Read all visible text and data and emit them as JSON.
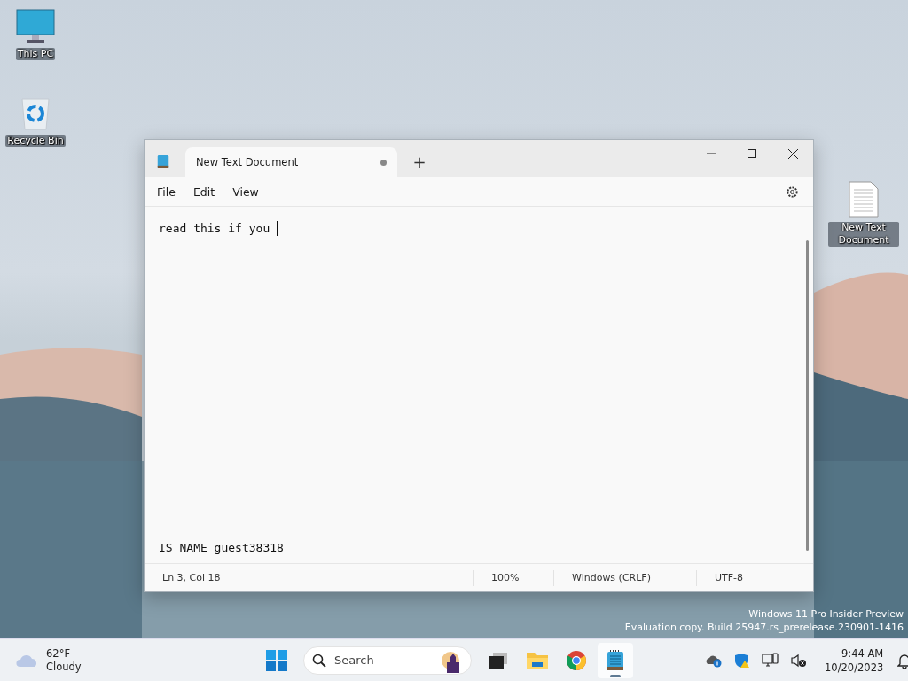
{
  "desktop_icons": [
    {
      "label": "This PC",
      "kind": "pc"
    },
    {
      "label": "Recycle Bin",
      "kind": "bin"
    },
    {
      "label": "New Text Document",
      "kind": "doc"
    }
  ],
  "window": {
    "tabs": [
      {
        "label": "New Text Document",
        "selected": true,
        "modified": true
      }
    ],
    "new_tab": "+",
    "menu": [
      "File",
      "Edit",
      "View"
    ],
    "editor": {
      "lines": [
        "read this if you ",
        "IS NAME guest38318"
      ]
    },
    "status_bar": [
      "Ln 3, Col 18",
      "100%",
      "Windows (CRLF)",
      "UTF-8"
    ]
  },
  "desktop_watermark": [
    "Windows 11 Pro Insider Preview",
    "Evaluation copy. Build 25947.rs_prerelease.230901-1416"
  ],
  "taskbar": {
    "weather": {
      "temperature": "62°F",
      "condition": "Cloudy"
    },
    "search": {
      "placeholder": "Search"
    },
    "apps": [
      {
        "kind": "start",
        "selected": false
      },
      {
        "kind": "taskview",
        "selected": false
      },
      {
        "kind": "explorer",
        "selected": false
      },
      {
        "kind": "chrome",
        "selected": false
      },
      {
        "kind": "notepad",
        "selected": true
      }
    ],
    "tray": [
      {
        "kind": "onedrive"
      },
      {
        "kind": "security"
      },
      {
        "kind": "network"
      },
      {
        "kind": "volume"
      }
    ],
    "clock": {
      "time": "9:44 AM",
      "date": "10/20/2023"
    }
  }
}
